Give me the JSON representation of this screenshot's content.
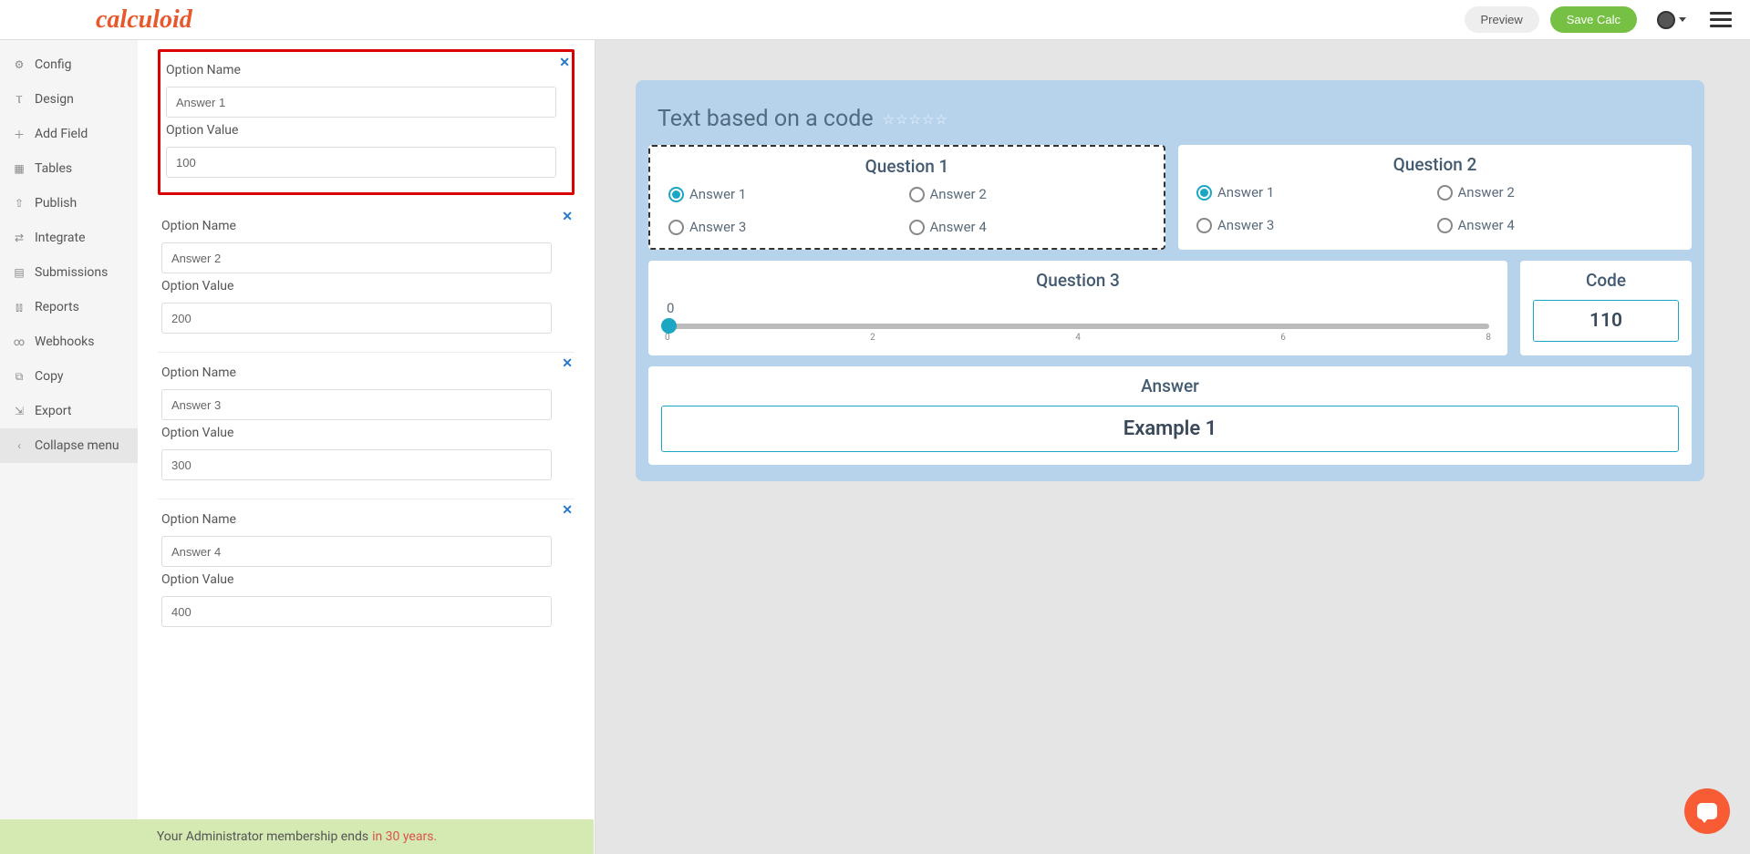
{
  "brand": "calculoid",
  "header": {
    "preview": "Preview",
    "save": "Save Calc"
  },
  "sidebar": {
    "items": [
      {
        "label": "Config"
      },
      {
        "label": "Design"
      },
      {
        "label": "Add Field"
      },
      {
        "label": "Tables"
      },
      {
        "label": "Publish"
      },
      {
        "label": "Integrate"
      },
      {
        "label": "Submissions"
      },
      {
        "label": "Reports"
      },
      {
        "label": "Webhooks"
      },
      {
        "label": "Copy"
      },
      {
        "label": "Export"
      }
    ],
    "collapse": "Collapse menu"
  },
  "editor": {
    "labels": {
      "name": "Option Name",
      "value": "Option Value"
    },
    "options": [
      {
        "name": "Answer 1",
        "value": "100"
      },
      {
        "name": "Answer 2",
        "value": "200"
      },
      {
        "name": "Answer 3",
        "value": "300"
      },
      {
        "name": "Answer 4",
        "value": "400"
      }
    ]
  },
  "preview": {
    "title": "Text based on a code",
    "q1": {
      "title": "Question 1",
      "opts": [
        "Answer 1",
        "Answer 2",
        "Answer 3",
        "Answer 4"
      ]
    },
    "q2": {
      "title": "Question 2",
      "opts": [
        "Answer 1",
        "Answer 2",
        "Answer 3",
        "Answer 4"
      ]
    },
    "q3": {
      "title": "Question 3",
      "value": "0",
      "ticks": [
        "0",
        "2",
        "4",
        "6",
        "8"
      ]
    },
    "code": {
      "title": "Code",
      "value": "110"
    },
    "answer": {
      "title": "Answer",
      "value": "Example 1"
    }
  },
  "footer": {
    "text": "Your Administrator membership ends",
    "suffix": "in 30 years."
  }
}
